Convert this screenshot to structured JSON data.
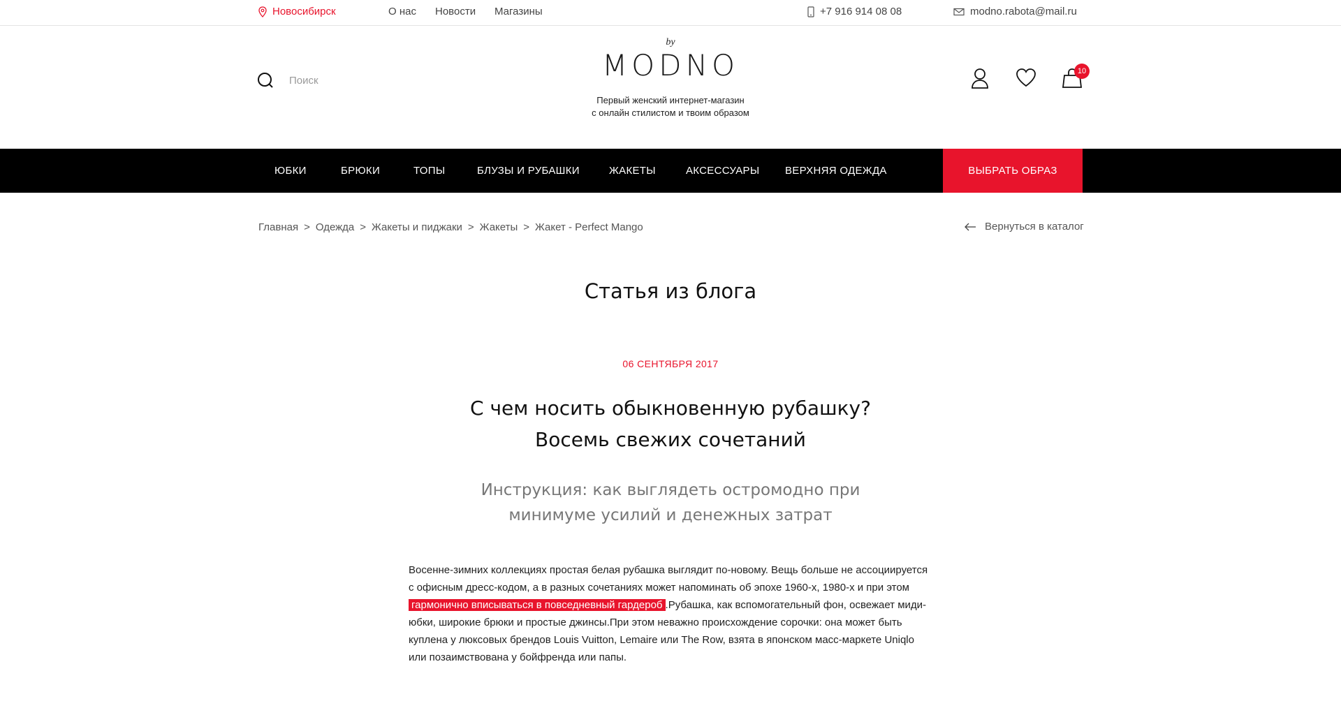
{
  "topbar": {
    "city": "Новосибирск",
    "nav": [
      "О нас",
      "Новости",
      "Магазины"
    ],
    "phone": "+7 916 914 08 08",
    "email": "modno.rabota@mail.ru"
  },
  "header": {
    "search_placeholder": "Поиск",
    "logo_by": "by",
    "logo": "MODNO",
    "tagline_1": "Первый женский интернет-магазин",
    "tagline_2": "с онлайн стилистом и твоим образом",
    "cart_count": "10"
  },
  "mainnav": {
    "items": [
      "ЮБКИ",
      "БРЮКИ",
      "ТОПЫ",
      "БЛУЗЫ И РУБАШКИ",
      "ЖАКЕТЫ",
      "АКСЕССУАРЫ",
      "ВЕРХНЯЯ ОДЕЖДА"
    ],
    "cta": "ВЫБРАТЬ ОБРАЗ"
  },
  "breadcrumbs": [
    "Главная",
    "Одежда",
    "Жакеты и пиджаки",
    "Жакеты",
    "Жакет - Perfect Mango"
  ],
  "back_label": "Вернуться в каталог",
  "page_heading": "Статья из блога",
  "article": {
    "date": "06 СЕНТЯБРЯ 2017",
    "title_1": "С чем носить обыкновенную рубашку?",
    "title_2": "Восемь свежих сочетаний",
    "subtitle_1": "Инструкция: как выглядеть остромодно при",
    "subtitle_2": "минимуме усилий и денежных затрат",
    "body_before": "Восенне-зимних коллекциях простая белая рубашка выглядит по-новому. Вещь больше не ассоциируется с офисным дресс-кодом, а в разных сочетаниях может напоминать об эпохе 1960-х, 1980-х и при этом ",
    "body_highlight": "гармонично вписываться в повседневный гардероб",
    "body_after": ".Рубашка, как вспомогательный фон, освежает миди-юбки, широкие брюки и простые джинсы.При этом неважно происхождение сорочки: она может быть куплена у люксовых брендов Louis Vuitton, Lemaire или The Row, взята в японском масс-маркете Uniqlo или позаимствована у бойфренда или папы."
  },
  "colors": {
    "accent": "#e8142c",
    "nav_bg": "#000000"
  }
}
